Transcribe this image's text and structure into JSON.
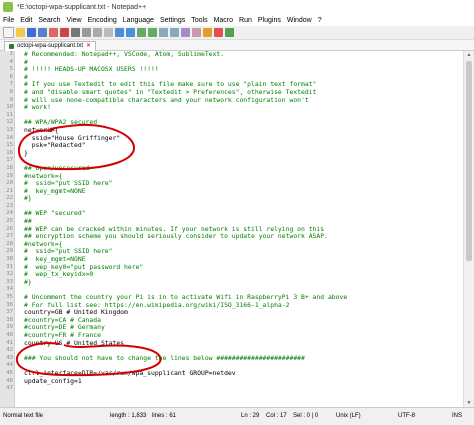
{
  "window": {
    "title": "*E:\\octopi-wpa-supplicant.txt - Notepad++"
  },
  "menu": [
    "File",
    "Edit",
    "Search",
    "View",
    "Encoding",
    "Language",
    "Settings",
    "Tools",
    "Macro",
    "Run",
    "Plugins",
    "Window",
    "?"
  ],
  "tab": {
    "label": "octopi-wpa-supplicant.txt"
  },
  "lines": [
    {
      "n": "3",
      "text": "# Recommended: Notepad++, VSCode, Atom, SublimeText."
    },
    {
      "n": "4",
      "text": "#"
    },
    {
      "n": "5",
      "text": "# !!!!! HEADS-UP MACOSX USERS !!!!!"
    },
    {
      "n": "6",
      "text": "#"
    },
    {
      "n": "7",
      "text": "# If you use Textedit to edit this file make sure to use \"plain text format\""
    },
    {
      "n": "8",
      "text": "# and \"disable smart quotes\" in \"Textedit > Preferences\", otherwise Textedit"
    },
    {
      "n": "9",
      "text": "# will use none-compatible characters and your network configuration won't"
    },
    {
      "n": "10",
      "text": "# work!"
    },
    {
      "n": "11",
      "text": ""
    },
    {
      "n": "12",
      "text": "## WPA/WPA2 secured"
    },
    {
      "n": "13",
      "text": "network={"
    },
    {
      "n": "14",
      "text": "  ssid=\"House Griffinger\""
    },
    {
      "n": "15",
      "text": "  psk=\"Redacted\""
    },
    {
      "n": "16",
      "text": "}"
    },
    {
      "n": "17",
      "text": ""
    },
    {
      "n": "18",
      "text": "## Open/unsecured"
    },
    {
      "n": "19",
      "text": "#network={"
    },
    {
      "n": "20",
      "text": "#  ssid=\"put SSID here\""
    },
    {
      "n": "21",
      "text": "#  key_mgmt=NONE"
    },
    {
      "n": "22",
      "text": "#}"
    },
    {
      "n": "23",
      "text": ""
    },
    {
      "n": "24",
      "text": "## WEP \"secured\""
    },
    {
      "n": "25",
      "text": "##"
    },
    {
      "n": "26",
      "text": "## WEP can be cracked within minutes. If your network is still relying on this"
    },
    {
      "n": "27",
      "text": "## encryption scheme you should seriously consider to update your network ASAP."
    },
    {
      "n": "28",
      "text": "#network={"
    },
    {
      "n": "29",
      "text": "#  ssid=\"put SSID here\""
    },
    {
      "n": "30",
      "text": "#  key_mgmt=NONE"
    },
    {
      "n": "31",
      "text": "#  wep_key0=\"put password here\""
    },
    {
      "n": "32",
      "text": "#  wep_tx_keyidx=0"
    },
    {
      "n": "33",
      "text": "#}"
    },
    {
      "n": "34",
      "text": ""
    },
    {
      "n": "35",
      "text": "# Uncomment the country your Pi is in to activate Wifi in RaspberryPi 3 B+ and above"
    },
    {
      "n": "36",
      "text": "# For full list see: https://en.wikipedia.org/wiki/ISO_3166-1_alpha-2"
    },
    {
      "n": "37",
      "text": "country=GB # United Kingdom"
    },
    {
      "n": "38",
      "text": "#country=CA # Canada"
    },
    {
      "n": "39",
      "text": "#country=DE # Germany"
    },
    {
      "n": "40",
      "text": "#country=FR # France"
    },
    {
      "n": "41",
      "text": "country=US # United States"
    },
    {
      "n": "42",
      "text": ""
    },
    {
      "n": "43",
      "text": "### You should not have to change the lines below #######################"
    },
    {
      "n": "44",
      "text": ""
    },
    {
      "n": "45",
      "text": "ctrl_interface=DIR=/var/run/wpa_supplicant GROUP=netdev"
    },
    {
      "n": "46",
      "text": "update_config=1"
    },
    {
      "n": "47",
      "text": ""
    }
  ],
  "status": {
    "file_type": "Normal text file",
    "length": "length : 1,833",
    "lines": "lines : 61",
    "position": "Ln : 29",
    "col": "Col : 17",
    "sel": "Sel : 0 | 0",
    "eol": "Unix (LF)",
    "encoding": "UTF-8",
    "mode": "INS"
  },
  "annotation_color": "#d40000"
}
